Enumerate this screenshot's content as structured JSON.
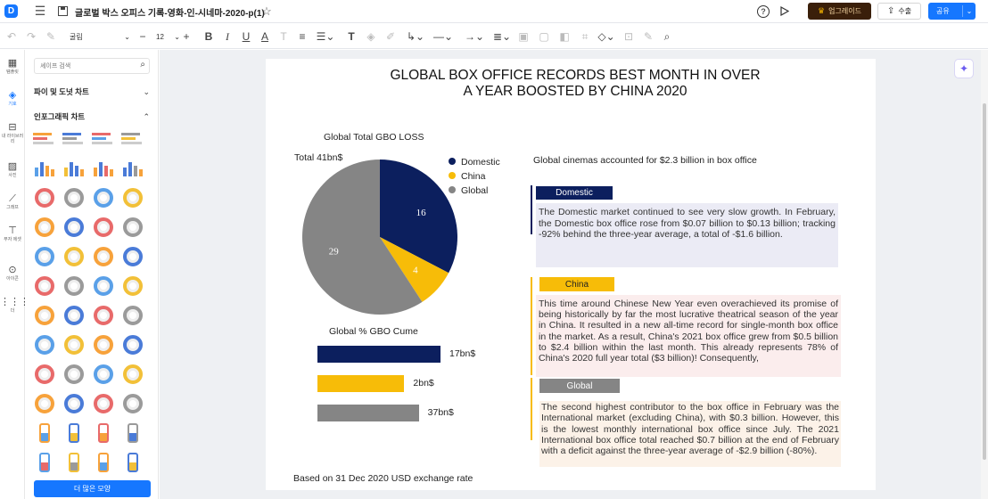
{
  "topbar": {
    "title": "글로벌 박스 오피스 기록-영화-인-시네마-2020-p(1)",
    "upgrade_label": "업그레이드",
    "export_label": "수출",
    "share_label": "공유"
  },
  "toolbar": {
    "font_family": "굴림",
    "font_size": "12"
  },
  "rail": {
    "items": [
      {
        "label": "템플릿"
      },
      {
        "label": "기호"
      },
      {
        "label": "내 라이브러리"
      },
      {
        "label": "사진"
      },
      {
        "label": "그래프"
      },
      {
        "label": "푸자 에셋"
      },
      {
        "label": "아이콘"
      },
      {
        "label": "더"
      }
    ]
  },
  "panel": {
    "search_placeholder": "셰이프 검색",
    "section1": "파이 및 도넛 차트",
    "section2": "인포그래픽 차트",
    "more_button": "더 많은 모양"
  },
  "document": {
    "title_line1": "GLOBAL BOX OFFICE RECORDS BEST MONTH IN OVER",
    "title_line2": "A YEAR BOOSTED BY CHINA 2020",
    "pie_title": "Global Total GBO LOSS",
    "pie_total": "Total 41bn$",
    "bar_title": "Global % GBO Cume",
    "footnote": "Based on 31 Dec 2020 USD exchange rate",
    "headline": "Global cinemas accounted for $2.3 billion in box office",
    "sections": [
      {
        "label": "Domestic",
        "text": "The Domestic market continued to see very slow growth. In February, the Domestic box office rose from $0.07 billion to $0.13 billion; tracking -92% behind the three-year average, a total of -$1.6 billion."
      },
      {
        "label": "China",
        "text": "This time around Chinese New Year even overachieved its promise of being historically by far the most lucrative theatrical season of the year in China. It resulted in a new all-time record for single-month box office in the market. As a result, China's 2021 box office grew from $0.5 billion to $2.4 billion within the last month. This already represents 78% of China's 2020 full year total ($3 billion)! Consequently,"
      },
      {
        "label": "Global",
        "text": "The second highest contributor to the box office in February was the International market (excluding China), with $0.3 billion. However, this is the lowest monthly international box office since July. The 2021 International box office total reached $0.7 billion at the end of February with a deficit against the three-year average of -$2.9 billion (-80%)."
      }
    ]
  },
  "colors": {
    "domestic": "#0c1f5e",
    "china": "#f7bc08",
    "global": "#858585",
    "domestic_bg": "#ebebf5",
    "china_bg": "#fbeded",
    "global_bg": "#fcf2e8",
    "accent": "#1677ff",
    "upgrade": "#3a1f0a"
  },
  "chart_data": [
    {
      "type": "pie",
      "title": "Global Total GBO LOSS",
      "categories": [
        "Domestic",
        "China",
        "Global"
      ],
      "values": [
        16,
        4,
        29
      ],
      "legend": "top-right"
    },
    {
      "type": "bar",
      "title": "Global % GBO Cume",
      "orientation": "horizontal",
      "categories": [
        "Domestic",
        "China",
        "Global"
      ],
      "values": [
        17,
        12,
        14
      ],
      "data_labels": [
        "17bn$",
        "2bn$",
        "37bn$"
      ]
    }
  ]
}
